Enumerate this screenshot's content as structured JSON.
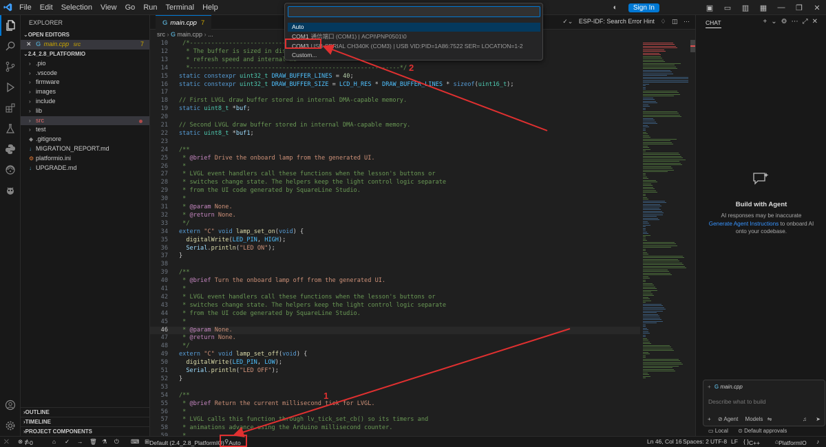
{
  "titlebar": {
    "menu": [
      "File",
      "Edit",
      "Selection",
      "View",
      "Go",
      "Run",
      "Terminal",
      "Help"
    ],
    "sign_in": "Sign In"
  },
  "explorer": {
    "title": "EXPLORER",
    "open_editors_label": "OPEN EDITORS",
    "open_file": "main.cpp",
    "open_file_dir": "src",
    "open_file_problems": "7",
    "project_label": "2.4_2.8_PLATFORMIO",
    "items": [
      {
        "name": ".pio",
        "type": "folder"
      },
      {
        "name": ".vscode",
        "type": "folder"
      },
      {
        "name": "firmware",
        "type": "folder"
      },
      {
        "name": "images",
        "type": "folder"
      },
      {
        "name": "include",
        "type": "folder"
      },
      {
        "name": "lib",
        "type": "folder"
      },
      {
        "name": "src",
        "type": "folder"
      },
      {
        "name": "test",
        "type": "folder"
      },
      {
        "name": ".gitignore",
        "type": "file"
      },
      {
        "name": "MIGRATION_REPORT.md",
        "type": "file"
      },
      {
        "name": "platformio.ini",
        "type": "file"
      },
      {
        "name": "UPGRADE.md",
        "type": "file"
      }
    ],
    "outline": "OUTLINE",
    "timeline": "TIMELINE",
    "project_components": "PROJECT COMPONENTS"
  },
  "editor": {
    "tab_label": "main.cpp",
    "tab_problems": "7",
    "breadcrumb": [
      "src",
      "main.cpp",
      "..."
    ],
    "tab_hint": "ESP-IDF: Search Error Hint",
    "lines": [
      {
        "n": "10",
        "t": " /*------------------------------------------------------------"
      },
      {
        "n": "12",
        "t": "  * The buffer is sized in display"
      },
      {
        "n": "13",
        "t": "  * refresh speed and internal me"
      },
      {
        "n": "14",
        "t": "  *-----------------------------------------------------------*/"
      },
      {
        "n": "15",
        "t": "static constexpr uint32_t DRAW_BUFFER_LINES = 40;"
      },
      {
        "n": "16",
        "t": "static constexpr uint32_t DRAW_BUFFER_SIZE = LCD_H_RES * DRAW_BUFFER_LINES * sizeof(uint16_t);"
      },
      {
        "n": "17",
        "t": ""
      },
      {
        "n": "18",
        "t": "// First LVGL draw buffer stored in internal DMA-capable memory."
      },
      {
        "n": "19",
        "t": "static uint8_t *buf;"
      },
      {
        "n": "20",
        "t": ""
      },
      {
        "n": "21",
        "t": "// Second LVGL draw buffer stored in internal DMA-capable memory."
      },
      {
        "n": "22",
        "t": "static uint8_t *buf1;"
      },
      {
        "n": "23",
        "t": ""
      },
      {
        "n": "24",
        "t": "/**"
      },
      {
        "n": "25",
        "t": " * @brief Drive the onboard lamp from the generated UI."
      },
      {
        "n": "26",
        "t": " *"
      },
      {
        "n": "27",
        "t": " * LVGL event handlers call these functions when the lesson's buttons or"
      },
      {
        "n": "28",
        "t": " * switches change state. The helpers keep the light control logic separate"
      },
      {
        "n": "29",
        "t": " * from the UI code generated by SquareLine Studio."
      },
      {
        "n": "30",
        "t": " *"
      },
      {
        "n": "31",
        "t": " * @param None."
      },
      {
        "n": "32",
        "t": " * @return None."
      },
      {
        "n": "33",
        "t": " */"
      },
      {
        "n": "34",
        "t": "extern \"C\" void lamp_set_on(void) {"
      },
      {
        "n": "35",
        "t": "  digitalWrite(LED_PIN, HIGH);"
      },
      {
        "n": "36",
        "t": "  Serial.println(\"LED ON\");"
      },
      {
        "n": "37",
        "t": "}"
      },
      {
        "n": "38",
        "t": ""
      },
      {
        "n": "39",
        "t": "/**"
      },
      {
        "n": "40",
        "t": " * @brief Turn the onboard lamp off from the generated UI."
      },
      {
        "n": "41",
        "t": " *"
      },
      {
        "n": "42",
        "t": " * LVGL event handlers call these functions when the lesson's buttons or"
      },
      {
        "n": "43",
        "t": " * switches change state. The helpers keep the light control logic separate"
      },
      {
        "n": "44",
        "t": " * from the UI code generated by SquareLine Studio."
      },
      {
        "n": "45",
        "t": " *"
      },
      {
        "n": "46",
        "t": " * @param None."
      },
      {
        "n": "47",
        "t": " * @return None."
      },
      {
        "n": "48",
        "t": " */"
      },
      {
        "n": "49",
        "t": "extern \"C\" void lamp_set_off(void) {"
      },
      {
        "n": "50",
        "t": "  digitalWrite(LED_PIN, LOW);"
      },
      {
        "n": "51",
        "t": "  Serial.println(\"LED OFF\");"
      },
      {
        "n": "52",
        "t": "}"
      },
      {
        "n": "53",
        "t": ""
      },
      {
        "n": "54",
        "t": "/**"
      },
      {
        "n": "55",
        "t": " * @brief Return the current millisecond tick for LVGL."
      },
      {
        "n": "56",
        "t": " *"
      },
      {
        "n": "57",
        "t": " * LVGL calls this function through lv_tick_set_cb() so its timers and"
      },
      {
        "n": "58",
        "t": " * animations advance using the Arduino millisecond counter."
      },
      {
        "n": "59",
        "t": " *"
      }
    ],
    "current_line": "46"
  },
  "quickpick": {
    "placeholder": "",
    "items": [
      {
        "label": "Auto",
        "desc": ""
      },
      {
        "label": "COM1",
        "desc": "通信端口 (COM1) | ACPI\\PNP0501\\0"
      },
      {
        "label": "COM3",
        "desc": "USB-SERIAL CH340K (COM3) | USB VID:PID=1A86:7522 SER= LOCATION=1-2"
      },
      {
        "label": "Custom...",
        "desc": ""
      }
    ]
  },
  "chat": {
    "header": "CHAT",
    "title": "Build with Agent",
    "subtitle_pre": "AI responses may be inaccurate",
    "subtitle_link": "Generate Agent Instructions",
    "subtitle_post": "to onboard AI onto your codebase.",
    "context_chip": "main.cpp",
    "placeholder": "Describe what to build",
    "mode": "Agent",
    "models": "Models",
    "local": "Local",
    "approvals": "Default approvals"
  },
  "statusbar": {
    "problems": "7",
    "warnings": "0",
    "env": "Default (2.4_2.8_PlatformIO)",
    "port": "Auto",
    "position": "Ln 46, Col 16",
    "spaces": "Spaces: 2",
    "encoding": "UTF-8",
    "eol": "LF",
    "language": "C++",
    "platformio": "PlatformIO"
  },
  "annotations": {
    "label1": "1",
    "label2": "2"
  },
  "colors": {
    "accent": "#0078d4",
    "annotation": "#e03030"
  }
}
